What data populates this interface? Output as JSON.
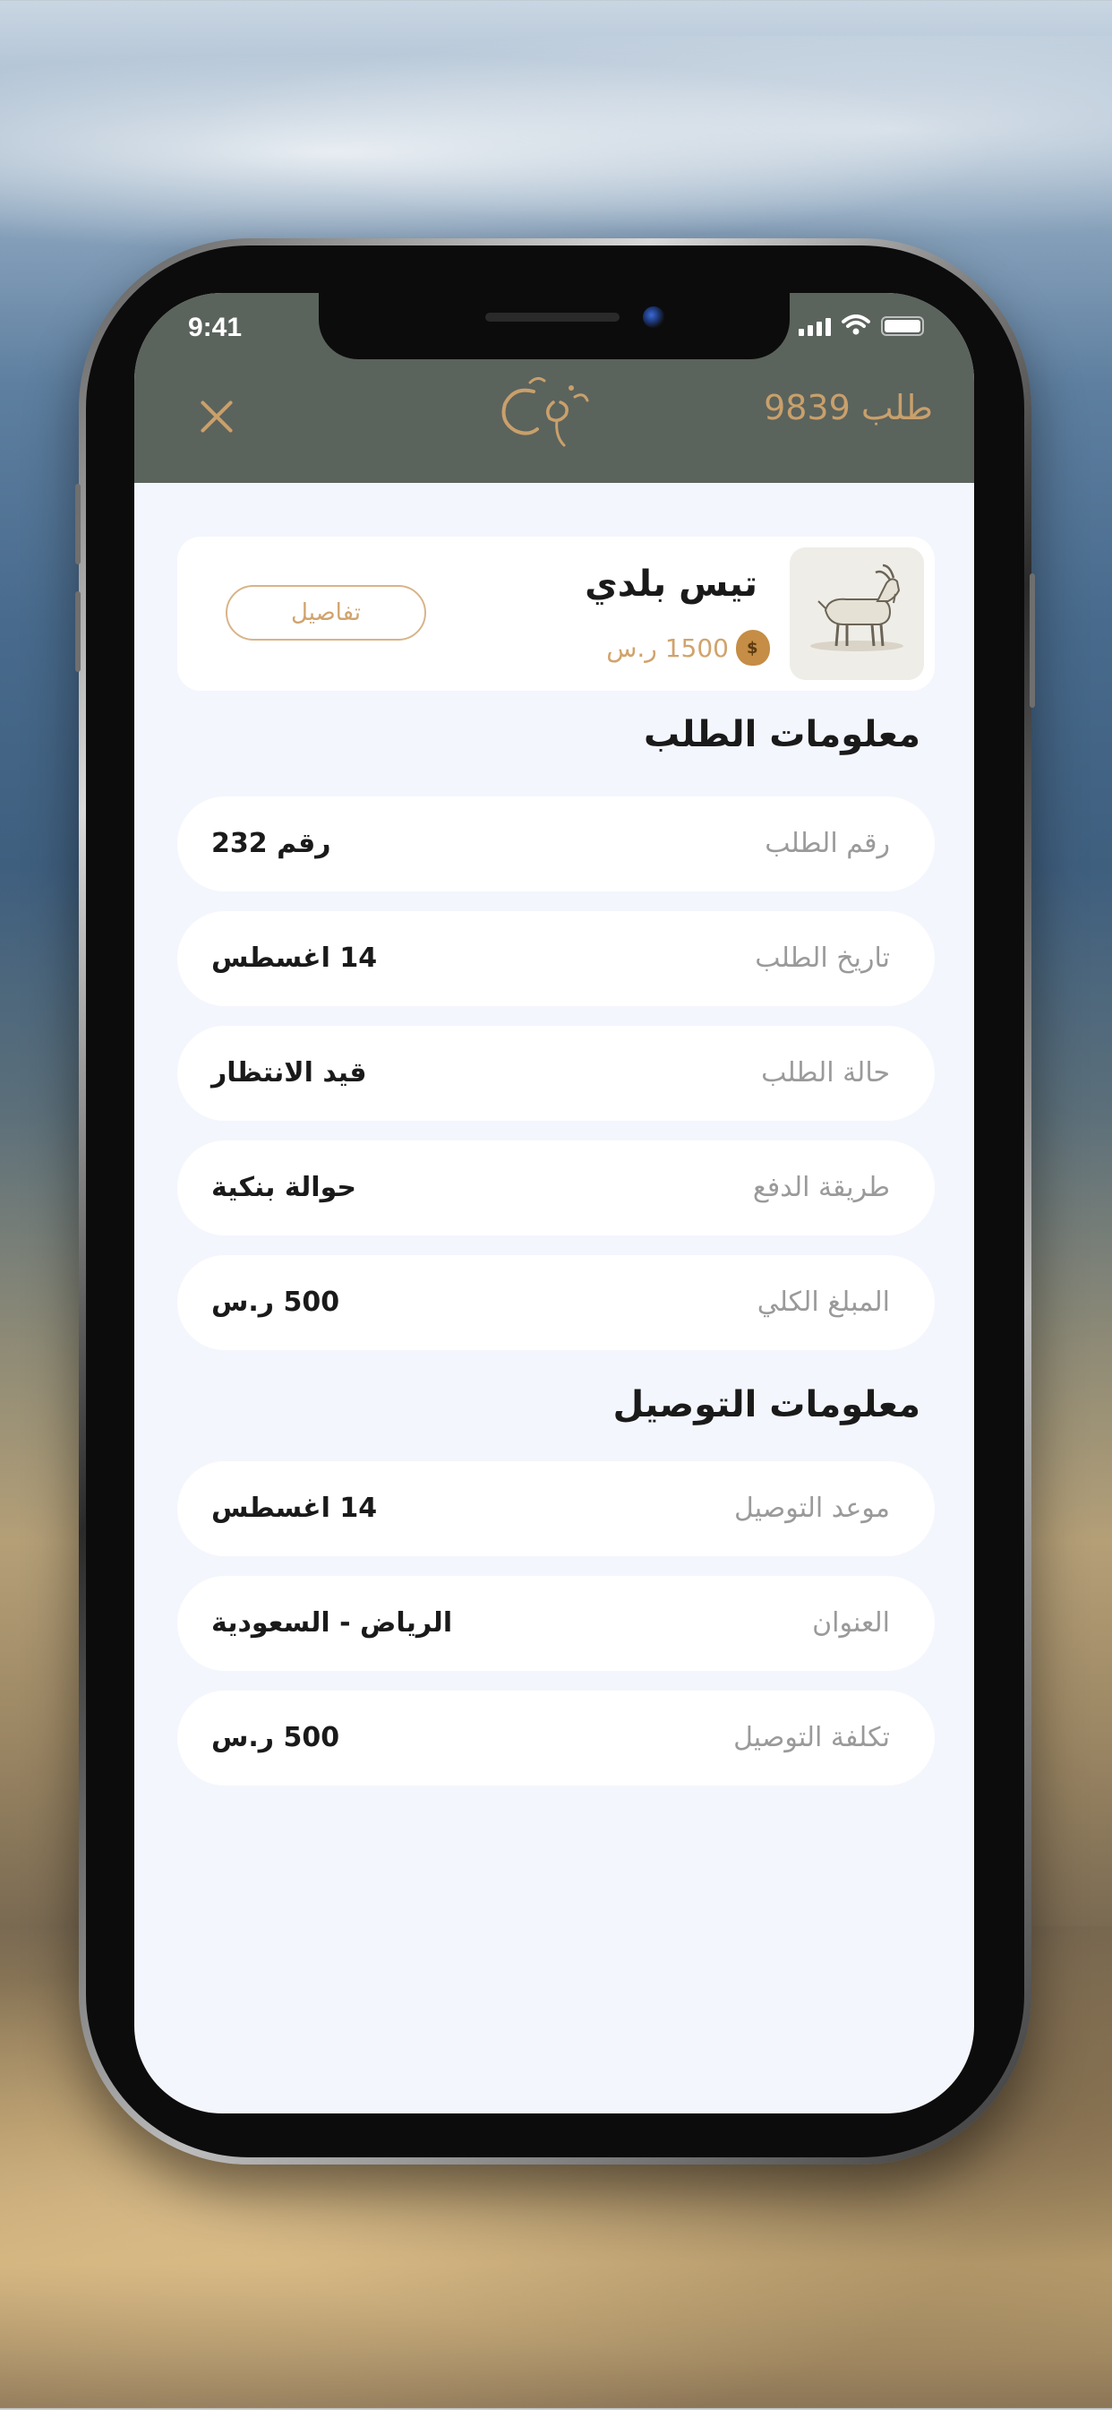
{
  "status_bar": {
    "time": "9:41"
  },
  "header": {
    "title": "طلب 9839",
    "background": "#5b635d",
    "accent": "#c9a06b"
  },
  "product": {
    "name": "تيس بلدي",
    "price": "1500 ر.س",
    "details_label": "تفاصيل"
  },
  "order_section": {
    "title": "معلومات الطلب",
    "rows": [
      {
        "label": "رقم الطلب",
        "value": "رقم 232"
      },
      {
        "label": "تاريخ الطلب",
        "value": "14 اغسطس"
      },
      {
        "label": "حالة الطلب",
        "value": "قيد الانتظار"
      },
      {
        "label": "طريقة الدفع",
        "value": "حوالة بنكية"
      },
      {
        "label": "المبلغ الكلي",
        "value": "500 ر.س"
      }
    ]
  },
  "delivery_section": {
    "title": "معلومات التوصيل",
    "rows": [
      {
        "label": "موعد التوصيل",
        "value": "14 اغسطس"
      },
      {
        "label": "العنوان",
        "value": "الرياض - السعودية"
      },
      {
        "label": "تكلفة التوصيل",
        "value": "500 ر.س"
      }
    ]
  }
}
